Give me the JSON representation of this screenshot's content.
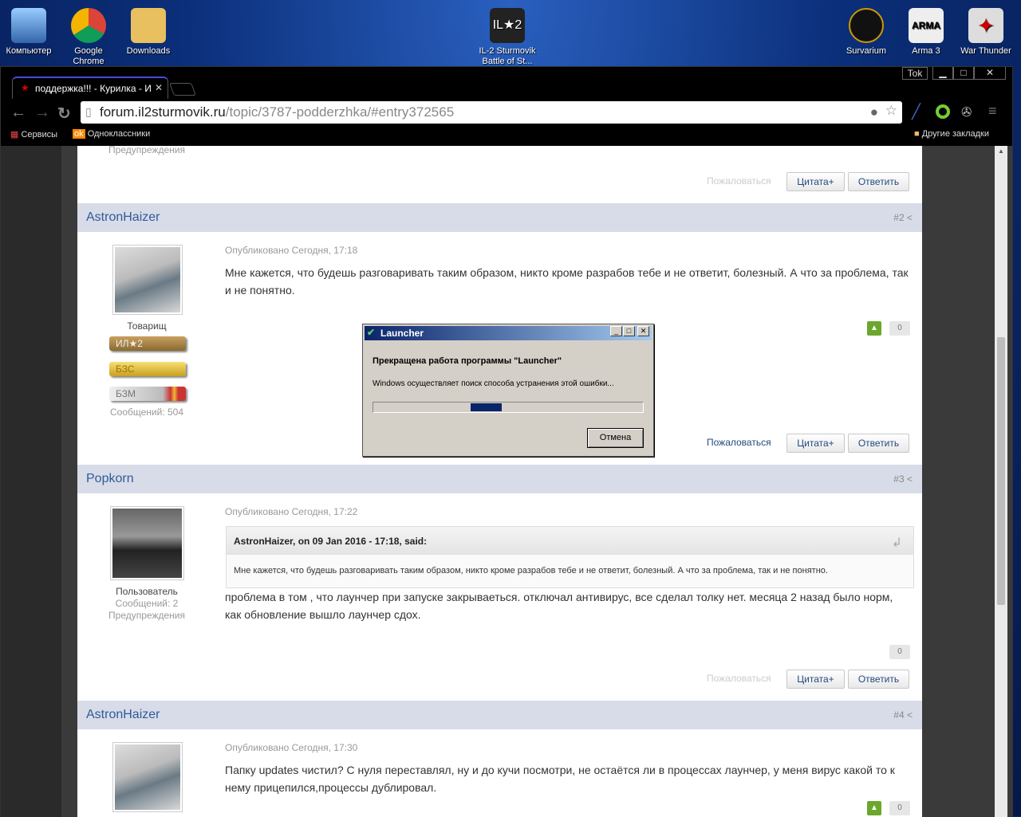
{
  "desktop": {
    "icons": [
      {
        "label": "Компьютер"
      },
      {
        "label": "Google Chrome"
      },
      {
        "label": "Downloads"
      },
      {
        "label": "IL-2 Sturmovik Battle of St..."
      },
      {
        "label": "Survarium"
      },
      {
        "label": "Arma 3"
      },
      {
        "label": "War Thunder"
      }
    ]
  },
  "browser": {
    "tab_title": "поддержка!!! - Курилка - И",
    "profile": "Tok",
    "url_host": "forum.il2sturmovik.ru",
    "url_path": "/topic/3787-podderzhka/#entry372565",
    "bookmarks": [
      "Сервисы",
      "Одноклассники"
    ],
    "other_bookmarks": "Другие закладки"
  },
  "page": {
    "report": "Пожаловаться",
    "quote": "Цитата+",
    "reply": "Ответить",
    "top_fragment": {
      "warnings": "Предупреждения"
    },
    "posts": [
      {
        "author": "AstronHaizer",
        "num": "#2",
        "date": "Опубликовано Сегодня, 17:18",
        "rank": "Товарищ",
        "badges": [
          "ИЛ★2",
          "БЗС",
          "БЗМ"
        ],
        "messages": "Сообщений: 504",
        "text": "Мне кажется, что будешь разговаривать таким образом, никто кроме разрабов тебе и не ответит, болезный. А что за проблема, так и не понятно.",
        "votes": "0"
      },
      {
        "author": "Popkorn",
        "num": "#3",
        "date": "Опубликовано Сегодня, 17:22",
        "rank": "Пользователь",
        "messages": "Сообщений: 2",
        "warnings": "Предупреждения",
        "quote_header": "AstronHaizer, on 09 Jan 2016 - 17:18, said:",
        "quote_text": "Мне кажется, что будешь разговаривать таким образом, никто кроме разрабов тебе и не ответит, болезный. А что за проблема, так и не понятно.",
        "text": "проблема в том , что лаунчер при запуске закрываеться. отключал антивирус, все сделал толку нет. месяца 2 назад было норм, как обновление вышло лаунчер сдох.",
        "votes": "0"
      },
      {
        "author": "AstronHaizer",
        "num": "#4",
        "date": "Опубликовано Сегодня, 17:30",
        "text": "Папку updates чистил? С нуля переставлял, ну и до кучи посмотри, не остаётся ли в процессах лаунчер, у меня вирус какой то к нему прицепился,процессы дублировал.",
        "votes": "0"
      }
    ]
  },
  "dialog": {
    "title": "Launcher",
    "heading": "Прекращена работа программы \"Launcher\"",
    "message": "Windows осуществляет поиск способа устранения этой ошибки...",
    "cancel": "Отмена"
  }
}
